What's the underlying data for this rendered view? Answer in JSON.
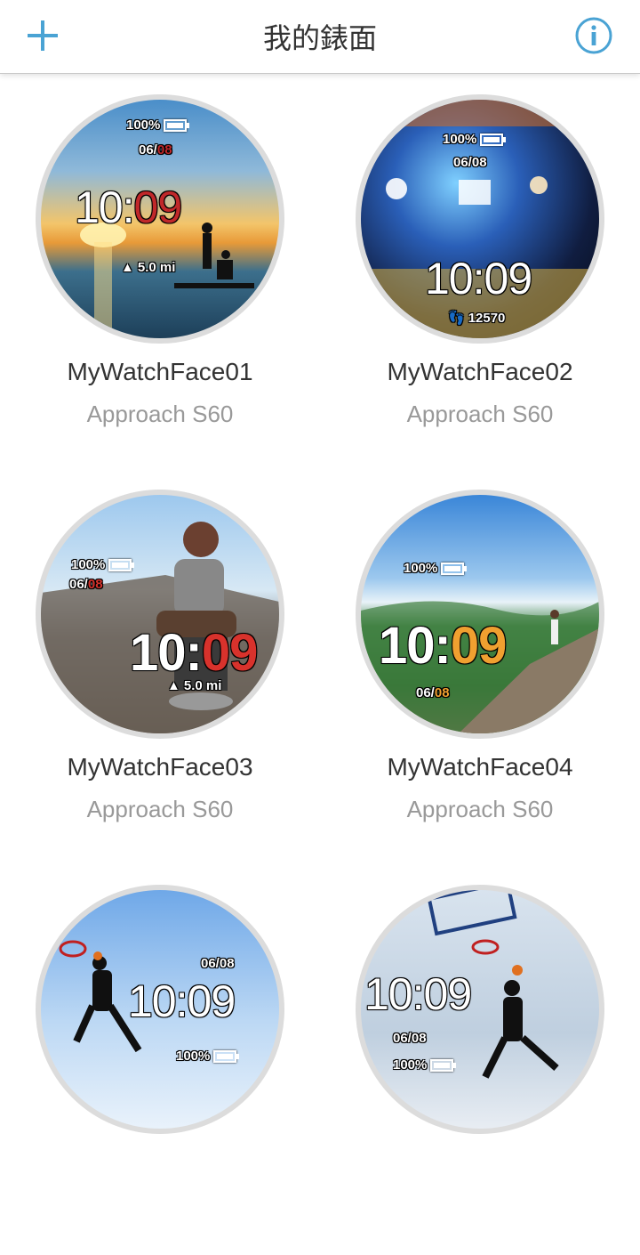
{
  "header": {
    "title": "我的錶面",
    "add_icon": "plus-icon",
    "info_icon": "info-icon",
    "accent": "#4aa3d4"
  },
  "faces": [
    {
      "name": "MyWatchFace01",
      "device": "Approach S60",
      "battery": "100%",
      "date_month": "06/",
      "date_day": "08",
      "time_hh": "10:",
      "time_mm": "09",
      "stat_icon": "distance-icon",
      "stat": "5.0 mi",
      "accent": "#c0282a"
    },
    {
      "name": "MyWatchFace02",
      "device": "Approach S60",
      "battery": "100%",
      "date_month": "06/",
      "date_day": "08",
      "time_hh": "10:",
      "time_mm": "09",
      "stat_icon": "steps-icon",
      "stat": "12570",
      "accent": "#ffffff"
    },
    {
      "name": "MyWatchFace03",
      "device": "Approach S60",
      "battery": "100%",
      "date_month": "06/",
      "date_day": "08",
      "time_hh": "10:",
      "time_mm": "09",
      "stat_icon": "distance-icon",
      "stat": "5.0 mi",
      "accent": "#d8322c"
    },
    {
      "name": "MyWatchFace04",
      "device": "Approach S60",
      "battery": "100%",
      "date_month": "06/",
      "date_day": "08",
      "time_hh": "10:",
      "time_mm": "09",
      "accent": "#f0a030"
    },
    {
      "battery": "100%",
      "date_month": "06/",
      "date_day": "08",
      "time_hh": "10:",
      "time_mm": "09",
      "accent": "#ffffff"
    },
    {
      "battery": "100%",
      "date_month": "06/",
      "date_day": "08",
      "time_hh": "10:",
      "time_mm": "09",
      "accent": "#ffffff"
    }
  ]
}
